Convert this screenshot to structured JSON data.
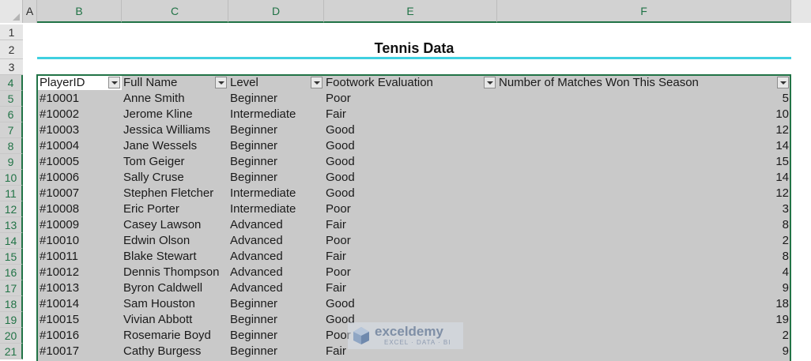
{
  "sheet": {
    "title": "Tennis Data",
    "columns": [
      "A",
      "B",
      "C",
      "D",
      "E",
      "F"
    ],
    "rows": [
      "1",
      "2",
      "3",
      "4",
      "5",
      "6",
      "7",
      "8",
      "9",
      "10",
      "11",
      "12",
      "13",
      "14",
      "15",
      "16",
      "17",
      "18",
      "19",
      "20",
      "21"
    ],
    "headers": [
      "PlayerID",
      "Full Name",
      "Level",
      "Footwork Evaluation",
      "Number of Matches Won This Season"
    ],
    "data": [
      [
        "#10001",
        "Anne Smith",
        "Beginner",
        "Poor",
        "5"
      ],
      [
        "#10002",
        "Jerome Kline",
        "Intermediate",
        "Fair",
        "10"
      ],
      [
        "#10003",
        "Jessica Williams",
        "Beginner",
        "Good",
        "12"
      ],
      [
        "#10004",
        "Jane Wessels",
        "Beginner",
        "Good",
        "14"
      ],
      [
        "#10005",
        "Tom Geiger",
        "Beginner",
        "Good",
        "15"
      ],
      [
        "#10006",
        "Sally Cruse",
        "Beginner",
        "Good",
        "14"
      ],
      [
        "#10007",
        "Stephen Fletcher",
        "Intermediate",
        "Good",
        "12"
      ],
      [
        "#10008",
        "Eric Porter",
        "Intermediate",
        "Poor",
        "3"
      ],
      [
        "#10009",
        "Casey Lawson",
        "Advanced",
        "Fair",
        "8"
      ],
      [
        "#10010",
        "Edwin Olson",
        "Advanced",
        "Poor",
        "2"
      ],
      [
        "#10011",
        "Blake Stewart",
        "Advanced",
        "Fair",
        "8"
      ],
      [
        "#10012",
        "Dennis Thompson",
        "Advanced",
        "Poor",
        "4"
      ],
      [
        "#10013",
        "Byron Caldwell",
        "Advanced",
        "Fair",
        "9"
      ],
      [
        "#10014",
        "Sam Houston",
        "Beginner",
        "Good",
        "18"
      ],
      [
        "#10015",
        "Vivian Abbott",
        "Beginner",
        "Good",
        "19"
      ],
      [
        "#10016",
        "Rosemarie Boyd",
        "Beginner",
        "Poor",
        "2"
      ],
      [
        "#10017",
        "Cathy Burgess",
        "Beginner",
        "Fair",
        "9"
      ]
    ]
  },
  "watermark": {
    "name": "exceldemy",
    "tagline": "EXCEL · DATA · BI"
  },
  "colors": {
    "accent": "#217346",
    "title_underline": "#3fd0e0",
    "table_fill": "#c9c9c9"
  }
}
